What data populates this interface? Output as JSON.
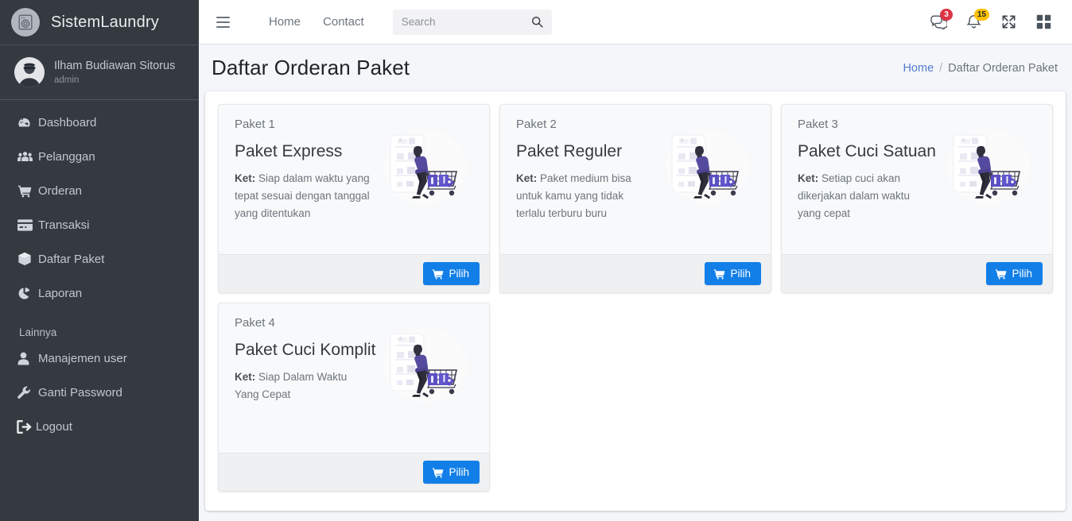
{
  "sidebar": {
    "brand": "SistemLaundry",
    "brand_logo_icon": "washing-machine-icon",
    "user": {
      "name": "Ilham Budiawan Sitorus",
      "role": "admin"
    },
    "items": [
      {
        "label": "Dashboard",
        "icon": "tachometer-icon"
      },
      {
        "label": "Pelanggan",
        "icon": "users-icon"
      },
      {
        "label": "Orderan",
        "icon": "shopping-cart-icon"
      },
      {
        "label": "Transaksi",
        "icon": "credit-card-icon"
      },
      {
        "label": "Daftar Paket",
        "icon": "box-icon"
      },
      {
        "label": "Laporan",
        "icon": "chart-pie-icon"
      }
    ],
    "section_header": "Lainnya",
    "more_items": [
      {
        "label": "Manajemen user",
        "icon": "user-icon"
      },
      {
        "label": "Ganti Password",
        "icon": "wrench-icon"
      },
      {
        "label": "Logout",
        "icon": "sign-out-icon"
      }
    ]
  },
  "navbar": {
    "menu_toggle_icon": "hamburger-icon",
    "links": [
      {
        "label": "Home"
      },
      {
        "label": "Contact"
      }
    ],
    "search": {
      "value": "",
      "placeholder": "Search",
      "icon": "search-icon"
    },
    "icons": [
      {
        "name": "comments-icon",
        "badge": "3",
        "badge_color": "#dc3545"
      },
      {
        "name": "bell-icon",
        "badge": "15",
        "badge_color": "#ffc107"
      },
      {
        "name": "expand-arrows-icon",
        "badge": ""
      },
      {
        "name": "th-large-icon",
        "badge": ""
      }
    ]
  },
  "header": {
    "title": "Daftar Orderan Paket",
    "breadcrumb": {
      "home": "Home",
      "separator": "/",
      "current": "Daftar Orderan Paket"
    }
  },
  "colors": {
    "sidebar_bg": "#343a40",
    "accent_link": "#547bd4",
    "button_blue": "#127fe8",
    "badge_danger": "#dc3545",
    "badge_warning": "#ffc107",
    "content_bg": "#f4f6f9"
  },
  "cards": [
    {
      "number": "Paket 1",
      "name": "Paket Express",
      "ket_label": "Ket:",
      "ket_text": " Siap dalam waktu yang tepat sesuai dengan tanggal yang ditentukan",
      "button": "Pilih",
      "button_icon": "shopping-cart-icon",
      "image": "shopping-cart-illustration"
    },
    {
      "number": "Paket 2",
      "name": "Paket Reguler",
      "ket_label": "Ket:",
      "ket_text": " Paket medium bisa untuk kamu yang tidak terlalu terburu buru",
      "button": "Pilih",
      "button_icon": "shopping-cart-icon",
      "image": "shopping-cart-illustration"
    },
    {
      "number": "Paket 3",
      "name": "Paket Cuci Satuan",
      "ket_label": "Ket:",
      "ket_text": " Setiap cuci akan dikerjakan dalam waktu yang cepat",
      "button": "Pilih",
      "button_icon": "shopping-cart-icon",
      "image": "shopping-cart-illustration"
    },
    {
      "number": "Paket 4",
      "name": "Paket Cuci Komplit",
      "ket_label": "Ket:",
      "ket_text": " Siap Dalam Waktu Yang Cepat",
      "button": "Pilih",
      "button_icon": "shopping-cart-icon",
      "image": "shopping-cart-illustration"
    }
  ]
}
